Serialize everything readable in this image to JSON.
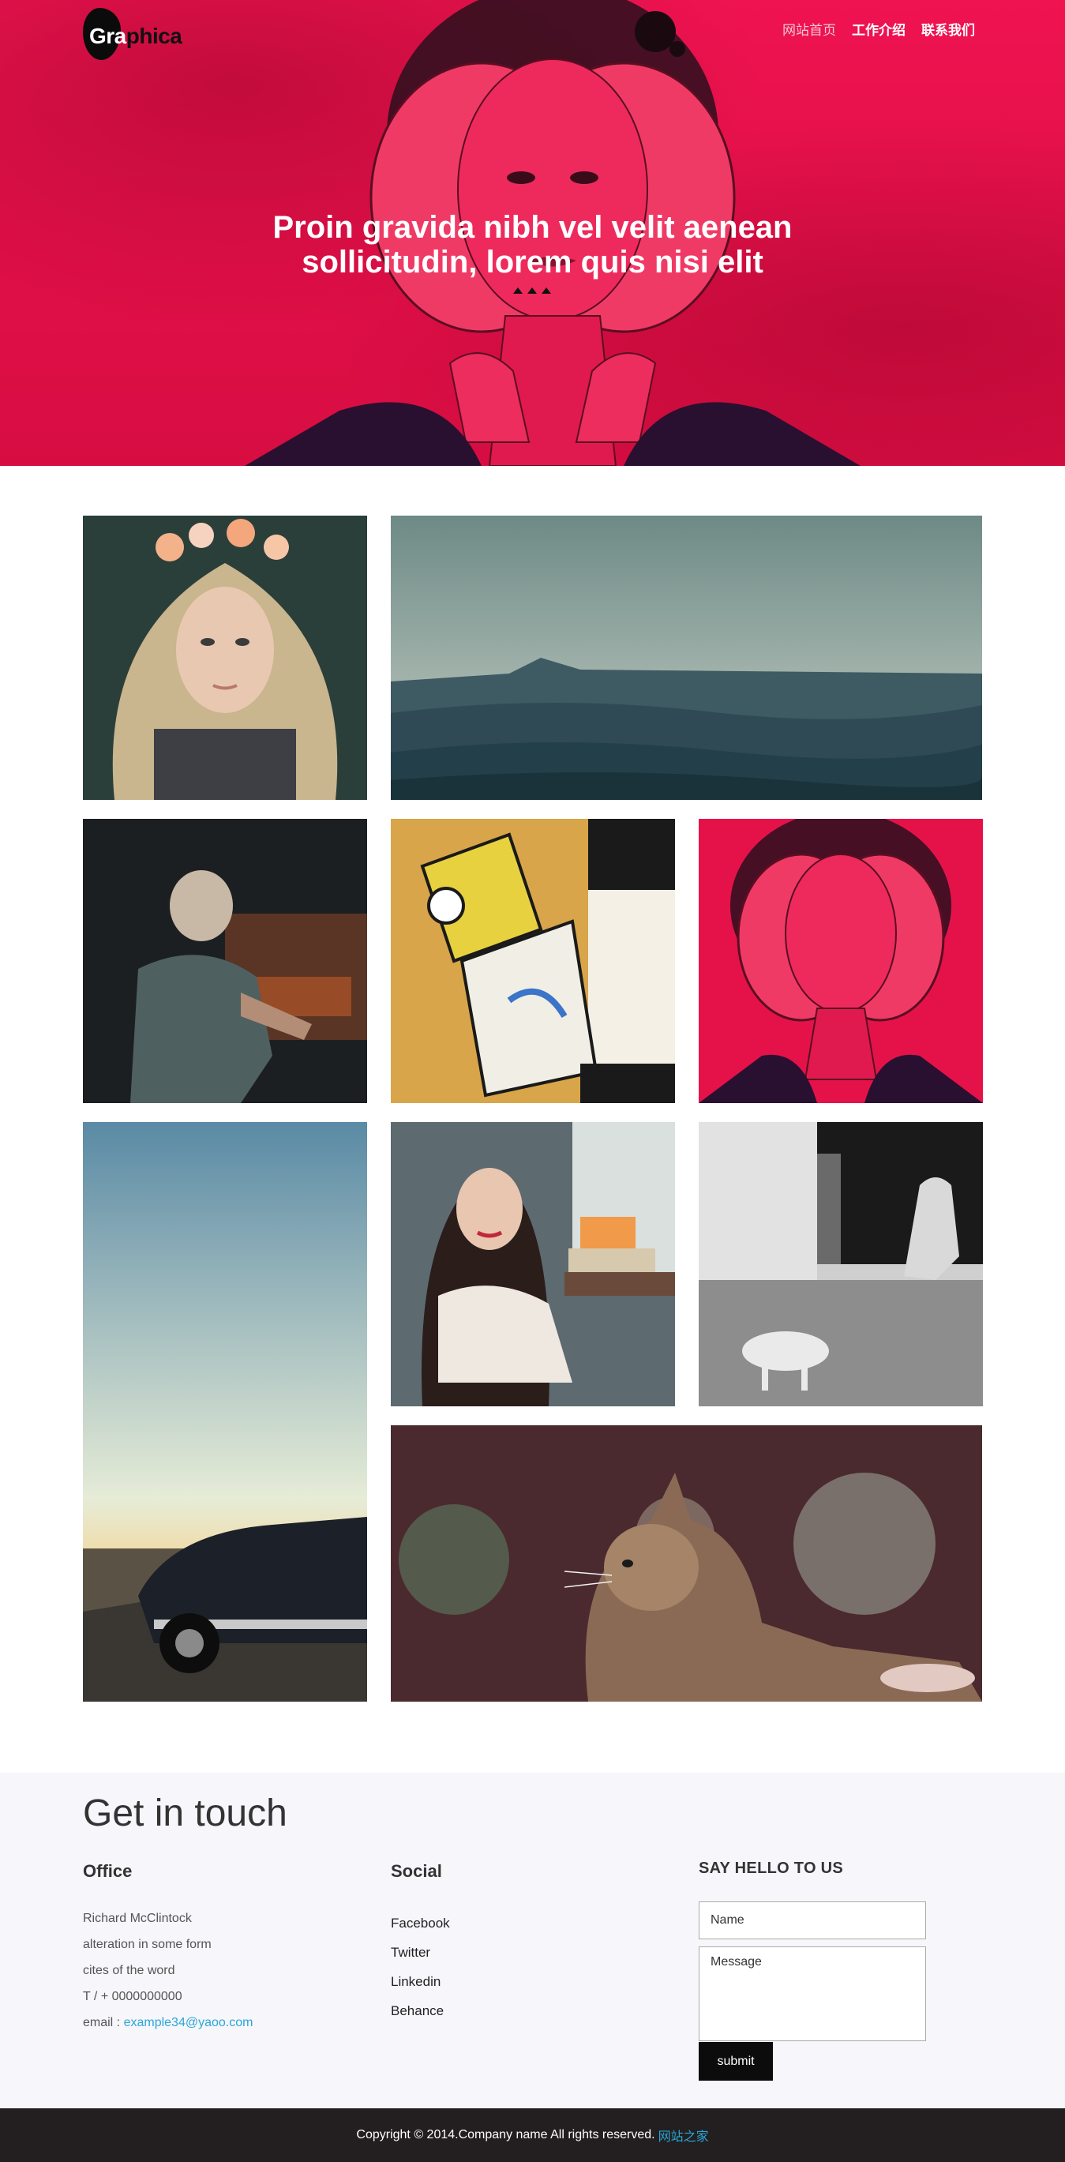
{
  "header": {
    "logo_part1": "Gra",
    "logo_part2": "phica",
    "nav": [
      {
        "label": "网站首页",
        "active": true
      },
      {
        "label": "工作介绍",
        "active": false
      },
      {
        "label": "联系我们",
        "active": false
      }
    ]
  },
  "hero": {
    "title_line1": "Proin gravida nibh vel velit aenean",
    "title_line2": "sollicitudin, lorem quis nisi elit",
    "slider_dots": 3,
    "colors": {
      "brand": "#e8124a"
    }
  },
  "gallery": {
    "tiles": [
      {
        "name": "tile-woman-flowers",
        "subject": "woman with flower crown"
      },
      {
        "name": "tile-misty-mountains",
        "subject": "misty mountains"
      },
      {
        "name": "tile-old-man-forge",
        "subject": "old man at forge"
      },
      {
        "name": "tile-abstract-painting",
        "subject": "abstract painting"
      },
      {
        "name": "tile-red-portrait",
        "subject": "red portrait"
      },
      {
        "name": "tile-car-sunset",
        "subject": "car on road at sunset"
      },
      {
        "name": "tile-woman-books",
        "subject": "woman with books"
      },
      {
        "name": "tile-street-dog",
        "subject": "street scene with dog"
      },
      {
        "name": "tile-cat",
        "subject": "cat"
      }
    ]
  },
  "contact": {
    "heading": "Get in touch",
    "office": {
      "title": "Office",
      "lines": [
        "Richard McClintock",
        "alteration in some form",
        "cites of the word",
        "T / + 0000000000"
      ],
      "email_label": "email : ",
      "email_value": "example34@yaoo.com"
    },
    "social": {
      "title": "Social",
      "links": [
        "Facebook",
        "Twitter",
        "Linkedin",
        "Behance"
      ]
    },
    "form": {
      "title": "SAY HELLO TO US",
      "name_placeholder": "Name",
      "message_placeholder": "Message",
      "submit_label": "submit"
    }
  },
  "footer": {
    "copyright": "Copyright © 2014.Company name All rights reserved.",
    "link_label": "网站之家"
  }
}
